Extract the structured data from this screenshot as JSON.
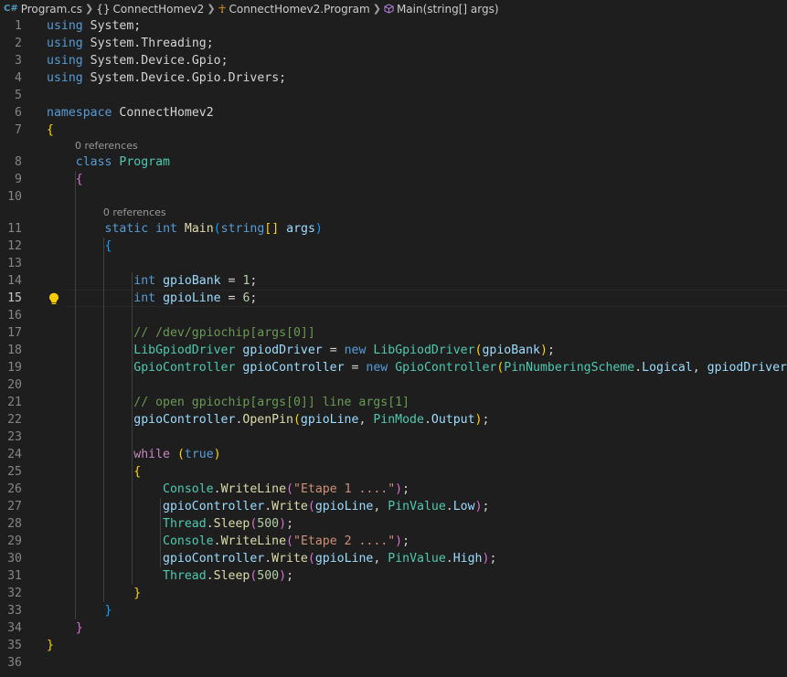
{
  "breadcrumb": {
    "file": "Program.cs",
    "namespace": "ConnectHomev2",
    "class": "ConnectHomev2.Program",
    "method": "Main(string[] args)",
    "file_icon": "csharp-file-icon",
    "namespace_icon": "namespace-braces-icon",
    "class_icon": "class-icon",
    "method_icon": "method-cube-icon"
  },
  "editor": {
    "active_line": 15,
    "codelens": [
      "0 references",
      "0 references"
    ],
    "lines": [
      {
        "n": "1",
        "code": "using System;"
      },
      {
        "n": "2",
        "code": "using System.Threading;"
      },
      {
        "n": "3",
        "code": "using System.Device.Gpio;"
      },
      {
        "n": "4",
        "code": "using System.Device.Gpio.Drivers;"
      },
      {
        "n": "5",
        "code": ""
      },
      {
        "n": "6",
        "code": "namespace ConnectHomev2"
      },
      {
        "n": "7",
        "code": "{"
      },
      {
        "n": "8",
        "code": "    class Program"
      },
      {
        "n": "9",
        "code": "    {"
      },
      {
        "n": "10",
        "code": ""
      },
      {
        "n": "11",
        "code": "        static int Main(string[] args)"
      },
      {
        "n": "12",
        "code": "        {"
      },
      {
        "n": "13",
        "code": ""
      },
      {
        "n": "14",
        "code": "            int gpioBank = 1;"
      },
      {
        "n": "15",
        "code": "            int gpioLine = 6;"
      },
      {
        "n": "16",
        "code": ""
      },
      {
        "n": "17",
        "code": "            // /dev/gpiochip[args[0]]"
      },
      {
        "n": "18",
        "code": "            LibGpiodDriver gpiodDriver = new LibGpiodDriver(gpioBank);"
      },
      {
        "n": "19",
        "code": "            GpioController gpioController = new GpioController(PinNumberingScheme.Logical, gpiodDriver);"
      },
      {
        "n": "20",
        "code": ""
      },
      {
        "n": "21",
        "code": "            // open gpiochip[args[0]] line args[1]"
      },
      {
        "n": "22",
        "code": "            gpioController.OpenPin(gpioLine, PinMode.Output);"
      },
      {
        "n": "23",
        "code": ""
      },
      {
        "n": "24",
        "code": "            while (true)"
      },
      {
        "n": "25",
        "code": "            {"
      },
      {
        "n": "26",
        "code": "                Console.WriteLine(\"Etape 1 ....\");"
      },
      {
        "n": "27",
        "code": "                gpioController.Write(gpioLine, PinValue.Low);"
      },
      {
        "n": "28",
        "code": "                Thread.Sleep(500);"
      },
      {
        "n": "29",
        "code": "                Console.WriteLine(\"Etape 2 ....\");"
      },
      {
        "n": "30",
        "code": "                gpioController.Write(gpioLine, PinValue.High);"
      },
      {
        "n": "31",
        "code": "                Thread.Sleep(500);"
      },
      {
        "n": "32",
        "code": "            }"
      },
      {
        "n": "33",
        "code": "        }"
      },
      {
        "n": "34",
        "code": "    }"
      },
      {
        "n": "35",
        "code": "}"
      },
      {
        "n": "36",
        "code": ""
      }
    ]
  },
  "colors": {
    "background": "#1e1e1e",
    "keyword": "#569cd6",
    "control": "#c586c0",
    "type": "#4ec9b0",
    "method": "#dcdcaa",
    "variable": "#9cdcfe",
    "number": "#b5cea8",
    "string": "#ce9178",
    "comment": "#6a9955",
    "bracket_level1": "#ffd700",
    "bracket_level2": "#da70d6",
    "bracket_level3": "#179fff",
    "lightbulb": "#ffcc00"
  }
}
